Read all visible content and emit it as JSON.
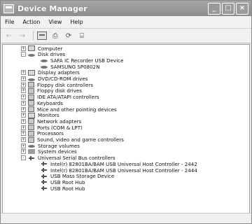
{
  "window": {
    "title": "Device Manager",
    "buttons": [
      "minimize",
      "maximize",
      "close"
    ]
  },
  "menubar": {
    "items": [
      "File",
      "Action",
      "View",
      "Help"
    ]
  },
  "toolbar": {
    "icons": [
      "back-arrow-icon",
      "forward-arrow-icon",
      "properties-icon",
      "print-icon",
      "refresh-icon",
      "help-icon"
    ]
  },
  "tree": {
    "rows": [
      {
        "label": "Computer",
        "icon": "monitor-icon",
        "level": 1,
        "expander": "+"
      },
      {
        "label": "Disk drives",
        "icon": "disk-icon",
        "level": 1,
        "expander": "-"
      },
      {
        "label": "SAFA IC Recorder USB Device",
        "icon": "disk-icon",
        "level": 2
      },
      {
        "label": "SAMSUNG SP0802N",
        "icon": "disk-icon",
        "level": 2
      },
      {
        "label": "Display adapters",
        "icon": "monitor-icon",
        "level": 1,
        "expander": "+"
      },
      {
        "label": "DVD/CD-ROM drives",
        "icon": "disk-icon",
        "level": 1,
        "expander": "+"
      },
      {
        "label": "Floppy disk controllers",
        "icon": "generic-icon",
        "level": 1,
        "expander": "+"
      },
      {
        "label": "Floppy disk drives",
        "icon": "generic-icon",
        "level": 1,
        "expander": "+"
      },
      {
        "label": "IDE ATA/ATAPI controllers",
        "icon": "generic-icon",
        "level": 1,
        "expander": "+"
      },
      {
        "label": "Keyboards",
        "icon": "generic-icon",
        "level": 1,
        "expander": "+"
      },
      {
        "label": "Mice and other pointing devices",
        "icon": "generic-icon",
        "level": 1,
        "expander": "+"
      },
      {
        "label": "Monitors",
        "icon": "monitor-icon",
        "level": 1,
        "expander": "+"
      },
      {
        "label": "Network adapters",
        "icon": "generic-icon",
        "level": 1,
        "expander": "+"
      },
      {
        "label": "Ports (COM & LPT)",
        "icon": "generic-icon",
        "level": 1,
        "expander": "+"
      },
      {
        "label": "Processors",
        "icon": "generic-icon",
        "level": 1,
        "expander": "+"
      },
      {
        "label": "Sound, video and game controllers",
        "icon": "generic-icon",
        "level": 1,
        "expander": "+"
      },
      {
        "label": "Storage volumes",
        "icon": "disk-icon",
        "level": 1,
        "expander": "+"
      },
      {
        "label": "System devices",
        "icon": "folder-icon",
        "level": 1,
        "expander": "+"
      },
      {
        "label": "Universal Serial Bus controllers",
        "icon": "usb-icon",
        "level": 1,
        "expander": "-"
      },
      {
        "label": "Intel(r) 82801BA/BAM USB Universal Host Controller - 2442",
        "icon": "usb-icon",
        "level": 2
      },
      {
        "label": "Intel(r) 82801BA/BAM USB Universal Host Controller - 2444",
        "icon": "usb-icon",
        "level": 2
      },
      {
        "label": "USB Mass Storage Device",
        "icon": "usb-icon",
        "level": 2
      },
      {
        "label": "USB Root Hub",
        "icon": "usb-icon",
        "level": 2
      },
      {
        "label": "USB Root Hub",
        "icon": "usb-icon",
        "level": 2
      }
    ]
  }
}
